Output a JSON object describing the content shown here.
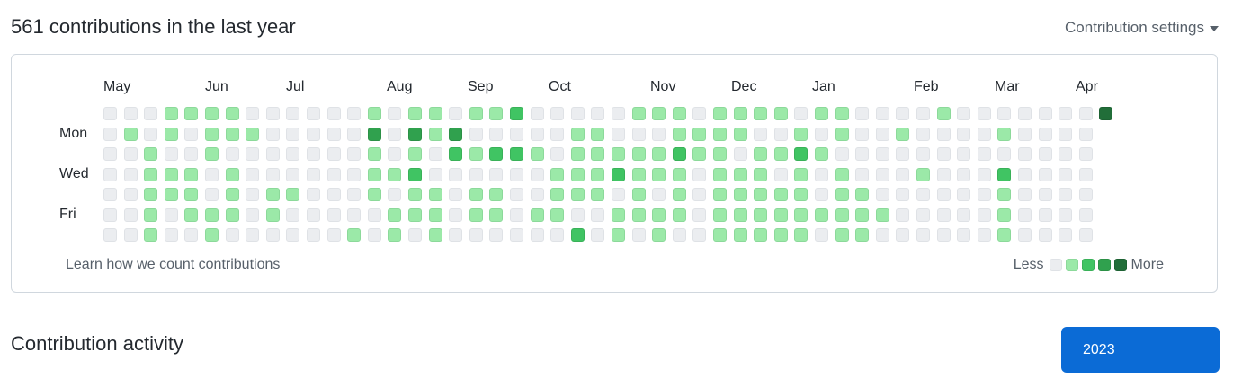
{
  "header": {
    "title": "561 contributions in the last year",
    "settings_label": "Contribution settings"
  },
  "graph": {
    "months": [
      "May",
      "Jun",
      "Jul",
      "Aug",
      "Sep",
      "Oct",
      "Nov",
      "Dec",
      "Jan",
      "Feb",
      "Mar",
      "Apr"
    ],
    "day_labels": [
      "Mon",
      "Wed",
      "Fri"
    ],
    "learn_link": "Learn how we count contributions",
    "legend_less": "Less",
    "legend_more": "More",
    "level_colors": [
      "#ebedf0",
      "#9be9a8",
      "#40c463",
      "#30a14e",
      "#216e39"
    ],
    "level_borders": [
      "#dfe2e6",
      "#8cd99a",
      "#39b158",
      "#2b9046",
      "#1d6233"
    ],
    "grid": [
      "0001111000000101101120000011101111011000010000000",
      "0101011100000303130000011000111100101001000010000",
      "0010010000000101021221011111211011210000000000000",
      "0011101000000112000000111211101110101000100020000",
      "0011101011000101101100111010101111101100000010000",
      "0010111010000011101101100111101111111110000010000",
      "0010010000001010100000020101001111101100000010000"
    ],
    "extra_cell": {
      "week": 49,
      "day": 0,
      "level": 4
    }
  },
  "activity": {
    "title": "Contribution activity",
    "year_button": "2023"
  }
}
